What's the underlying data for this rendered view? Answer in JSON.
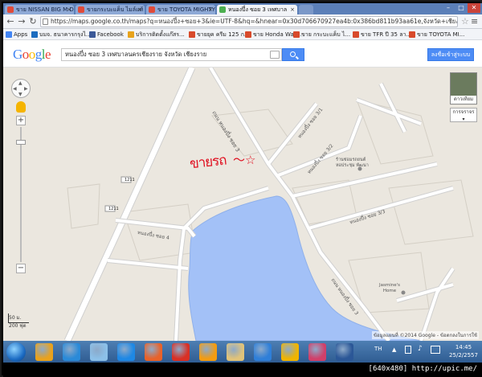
{
  "browser": {
    "tabs": [
      {
        "label": "ขาย NISSAN BIG M D",
        "active": false
      },
      {
        "label": "ขายกระบะแค็บ ไมล์แท้",
        "active": false
      },
      {
        "label": "ขาย TOYOTA MIGHTY-X",
        "active": false
      },
      {
        "label": "หนองปึ๋ง ซอย 3 เทศบาล",
        "active": true
      }
    ],
    "url": "https://maps.google.co.th/maps?q=หนองปึ๋ง+ซอย+3&ie=UTF-8&hq=&hnear=0x30d706670927ea4b:0x386bd811b93aa61e,จังหวัด+เชียงราย&gl=th&ei=6UYMU_e",
    "bookmarks": [
      {
        "label": "Apps",
        "color": "#4285f4"
      },
      {
        "label": "บมจ. ธนาคารกรุงไ...",
        "color": "#1b6cbf"
      },
      {
        "label": "Facebook",
        "color": "#3b5998"
      },
      {
        "label": "บริการติดตั้งแก๊สร...",
        "color": "#e8a31c"
      },
      {
        "label": "ขายยุค ครีม 125 ก...",
        "color": "#d84a2b"
      },
      {
        "label": "ขาย Honda Wav...",
        "color": "#d84a2b"
      },
      {
        "label": "ขาย กระบะแค็บ ไ...",
        "color": "#d84a2b"
      },
      {
        "label": "ขาย TFR ปี 35 ลา...",
        "color": "#d84a2b"
      },
      {
        "label": "ขาย TOYOTA MI...",
        "color": "#d84a2b"
      }
    ]
  },
  "google": {
    "logo_letters": [
      {
        "ch": "G",
        "color": "#4285f4"
      },
      {
        "ch": "o",
        "color": "#ea4335"
      },
      {
        "ch": "o",
        "color": "#fbbc05"
      },
      {
        "ch": "g",
        "color": "#4285f4"
      },
      {
        "ch": "l",
        "color": "#34a853"
      },
      {
        "ch": "e",
        "color": "#ea4335"
      }
    ],
    "search_value": "หนองปึ๋ง ซอย 3 เทศบาลนครเชียงราย จังหวัด เชียงราย",
    "signin_label": "ลงชื่อเข้าสู่ระบบ"
  },
  "map": {
    "satellite_label": "ดาวเทียม",
    "traffic_label": "การจราจร",
    "handwritten_label": "ขายรถ",
    "road_labels": {
      "soi_main": "ถนน หนองปึ๋ง ซอย 3",
      "soi_3_1": "หนองปึ๋ง ซอย 3/1",
      "soi_3_2": "หนองปึ๋ง ซอย 3/2",
      "soi_3_3": "หนองปึ๋ง ซอย 3/3",
      "soi_4": "หนองปึ๋ง ซอย 4",
      "road_1211_a": "1211",
      "road_1211_b": "1211",
      "soi_main_bottom": "ถนน หนองปึ๋ง ซอย 3"
    },
    "place_1": "ร้านซ่อมรถยนต์\nหอประชุม พัฒนา",
    "place_2": "Jasmine's\nHome",
    "scale_top": "50 ม.",
    "scale_bottom": "200 ฟุต",
    "copyright": "ข้อมูลแผนที่ ©2014 Google - ข้อตกลงในการใช้"
  },
  "taskbar": {
    "icons": [
      "#e9a21d",
      "#2a8ad8",
      "#8cc0e8",
      "#1e88e5",
      "#e8622a",
      "#d93025",
      "#f39c12",
      "#e0c37a",
      "#2f7fd8",
      "#f0b400",
      "#d1406a",
      "#2b5797"
    ],
    "lang": "TH",
    "time": "14:45",
    "date": "25/2/2557"
  },
  "watermark": "[640x480] http://upic.me/"
}
